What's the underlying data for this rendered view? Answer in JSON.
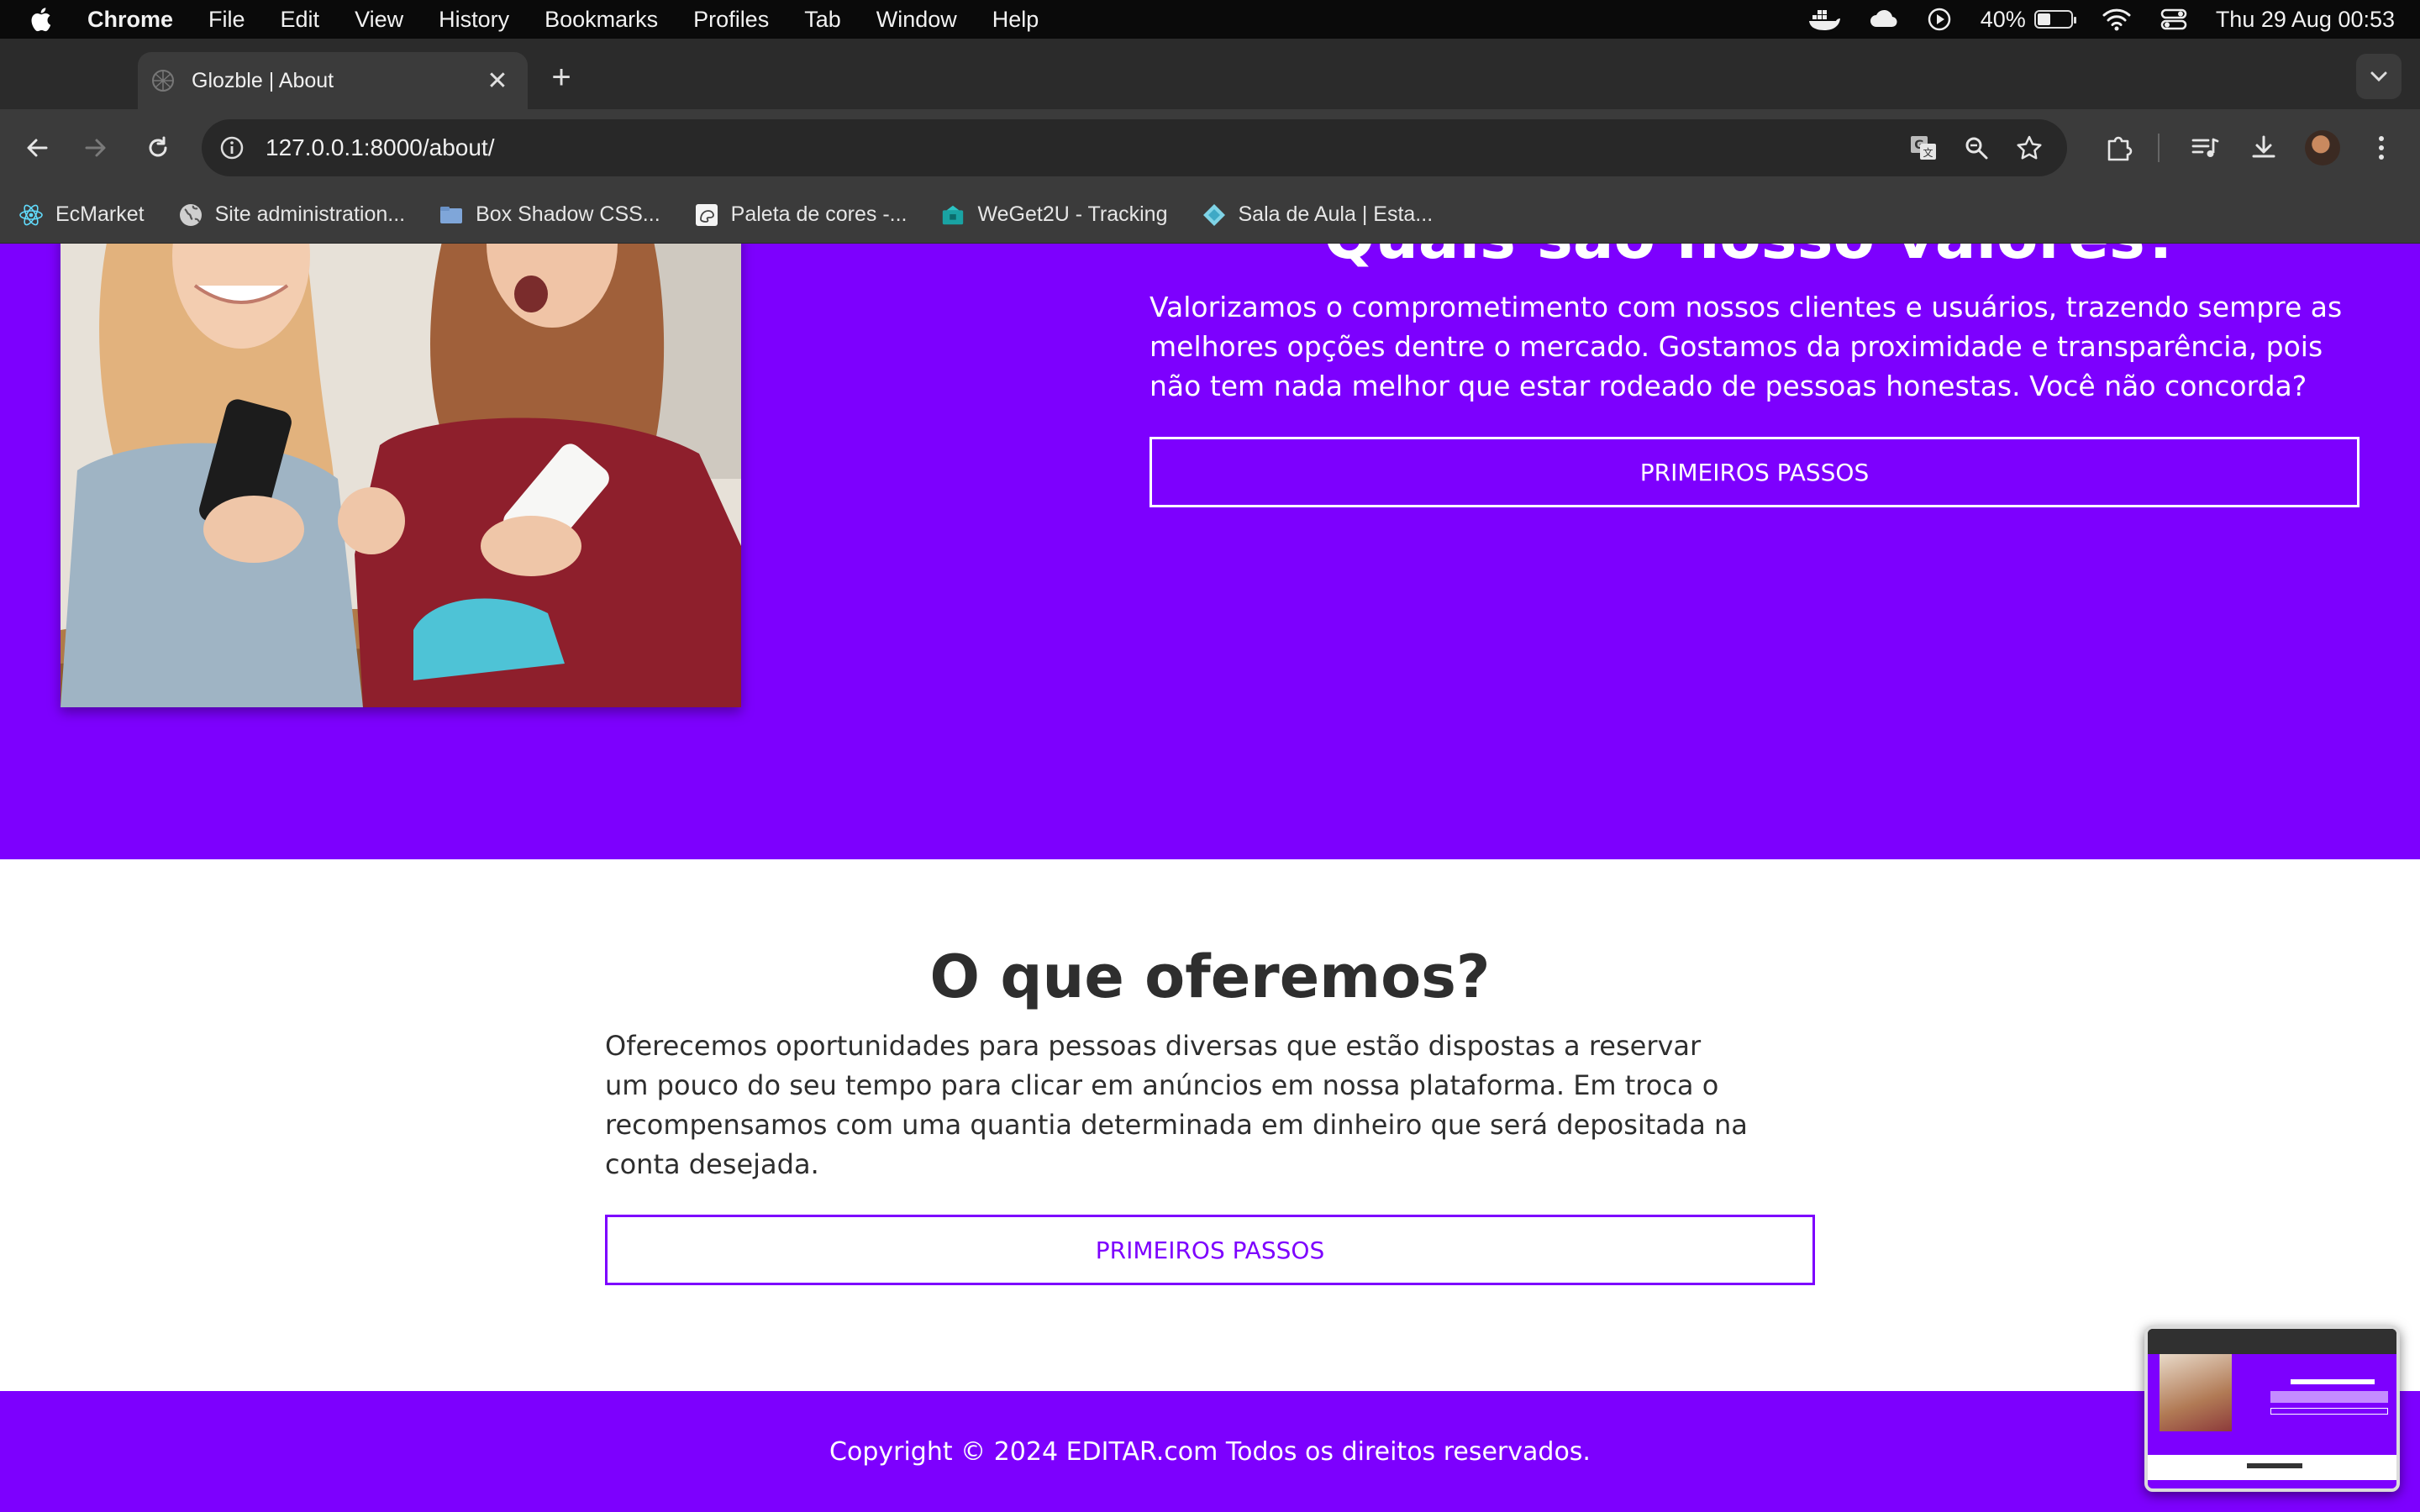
{
  "menubar": {
    "app_name": "Chrome",
    "menus": [
      "File",
      "Edit",
      "View",
      "History",
      "Bookmarks",
      "Profiles",
      "Tab",
      "Window",
      "Help"
    ],
    "battery_percent": "40%",
    "battery_level": 0.4,
    "datetime": "Thu 29 Aug  00:53"
  },
  "browser": {
    "tab_title": "Glozble | About",
    "url": "127.0.0.1:8000/about/",
    "bookmarks": [
      {
        "label": "EcMarket",
        "icon": "react-icon"
      },
      {
        "label": "Site administration...",
        "icon": "globe-icon"
      },
      {
        "label": "Box Shadow CSS...",
        "icon": "folder-icon"
      },
      {
        "label": "Paleta de cores -...",
        "icon": "palette-icon"
      },
      {
        "label": "WeGet2U - Tracking",
        "icon": "weget-icon"
      },
      {
        "label": "Sala de Aula | Esta...",
        "icon": "diamond-icon"
      }
    ]
  },
  "page": {
    "values_section": {
      "title": "Quais são nosso valores?",
      "text": "Valorizamos o comprometimento com nossos clientes e usuários, trazendo sempre as melhores opções dentre o mercado. Gostamos da proximidade e transparência, pois não tem nada melhor que estar rodeado de pessoas honestas. Você não concorda?",
      "button": "PRIMEIROS PASSOS"
    },
    "offer_section": {
      "title": "O que oferemos?",
      "text": "Oferecemos oportunidades para pessoas diversas que estão dispostas a reservar um pouco do seu tempo para clicar em anúncios em nossa plataforma. Em troca o recompensamos com uma quantia determinada em dinheiro que será depositada na conta desejada.",
      "button": "PRIMEIROS PASSOS"
    },
    "footer": {
      "copyright": "Copyright © 2024 EDITAR.com Todos os direitos reservados."
    }
  },
  "colors": {
    "brand_purple": "#7d00fe",
    "text_dark": "#2e2e2e"
  }
}
